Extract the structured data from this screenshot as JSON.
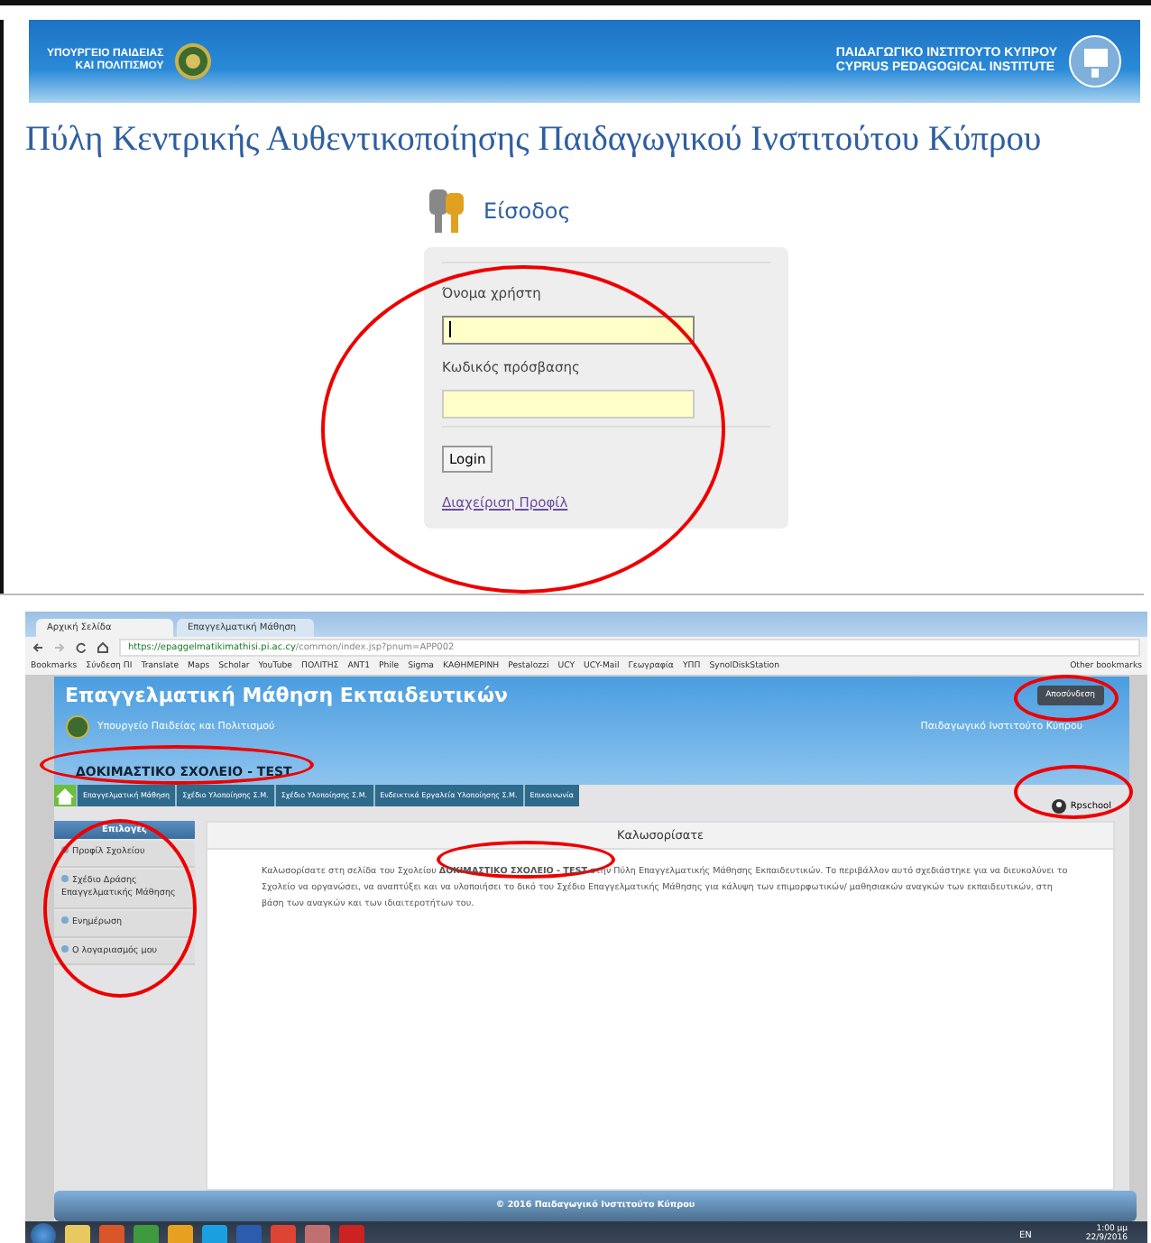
{
  "banner": {
    "ministry_lines": [
      "ΥΠΟΥΡΓΕΙΟ ΠΑΙΔΕΙΑΣ",
      "ΚΑΙ ΠΟΛΙΤΙΣΜΟΥ"
    ],
    "institute_lines": [
      "ΠΑΙΔΑΓΩΓΙΚΟ ΙΝΣΤΙΤΟΥΤΟ ΚΥΠΡΟΥ",
      "CYPRUS PEDAGOGICAL INSTITUTE"
    ]
  },
  "portal_title": "Πύλη Κεντρικής Αυθεντικοποίησης Παιδαγωγικού Ινστιτούτου Κύπρου",
  "login": {
    "heading": "Είσοδος",
    "fields": [
      {
        "label": "Όνομα χρήστη",
        "focused": true
      },
      {
        "label": "Κωδικός πρόσβασης",
        "focused": false
      }
    ],
    "button": "Login",
    "link": "Διαχείριση Προφίλ"
  },
  "browser": {
    "tabs": [
      {
        "label": "Αρχική Σελίδα",
        "selected": true
      },
      {
        "label": "Επαγγελματική Μάθηση",
        "selected": false
      }
    ],
    "url_host": "https://epaggelmatikimathisi.pi.ac.cy",
    "url_path": "/common/index.jsp?pnum=APP002",
    "bookmarks": [
      "Bookmarks",
      "Σύνδεση ΠΙ",
      "Translate",
      "Maps",
      "Scholar",
      "YouTube",
      "ΠΟΛΙΤΗΣ",
      "ΑΝΤ1",
      "Phile",
      "Sigma",
      "ΚΑΘΗΜΕΡΙΝΗ",
      "Pestalozzi",
      "UCY",
      "UCY-Mail",
      "Γεωγραφία",
      "ΥΠΠ",
      "SynolDiskStation"
    ],
    "other_bookmarks": "Other bookmarks"
  },
  "app": {
    "title": "Επαγγελματική Μάθηση Εκπαιδευτικών",
    "logout": "Αποσύνδεση",
    "ministry": "Υπουργείο Παιδείας και Πολιτισμού",
    "institute": "Παιδαγωγικό Ινστιτούτο Κύπρου",
    "school": "ΔΟΚΙΜΑΣΤΙΚΟ ΣΧΟΛΕΙΟ - TEST",
    "nav": [
      "Επαγγελματική Μάθηση",
      "Σχέδιο Υλοποίησης Σ.Μ.",
      "Σχέδιο Υλοποίησης Σ.Μ.",
      "Ενδεικτικά Εργαλεία Υλοποίησης Σ.Μ.",
      "Επικοινωνία"
    ],
    "user": "Rpschool",
    "sidebar": {
      "title": "Επιλογές",
      "items": [
        "Προφίλ Σχολείου",
        "Σχέδιο Δράσης Επαγγελματικής Μάθησης",
        "Ενημέρωση",
        "Ο λογαριασμός μου"
      ]
    },
    "content_title": "Καλωσορίσατε",
    "welcome": "Καλωσορίσατε στη σελίδα του Σχολείου **ΔΟΚΙΜΑΣΤΙΚΟ ΣΧΟΛΕΙΟ - TEST** στην Πύλη Επαγγελματικής Μάθησης Εκπαιδευτικών. Το περιβάλλον αυτό σχεδιάστηκε για να διευκολύνει το Σχολείο να οργανώσει, να αναπτύξει και να υλοποιήσει το δικό του Σχέδιο Επαγγελματικής Μάθησης για κάλυψη των επιμορφωτικών/ μαθησιακών αναγκών των εκπαιδευτικών, στη βάση των αναγκών και των ιδιαιτεροτήτων του.",
    "footer": "© 2016 Παιδαγωγικό Ινστιτούτο Κύπρου"
  },
  "taskbar": {
    "language": "EN",
    "time": "1:00 μμ",
    "date": "22/9/2016"
  }
}
